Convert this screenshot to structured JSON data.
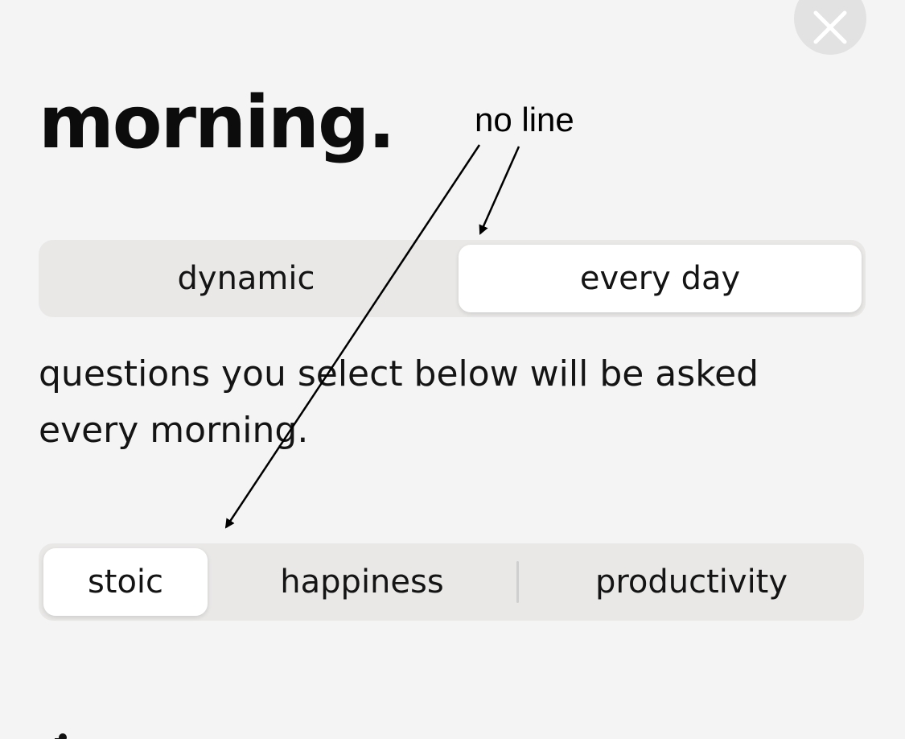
{
  "header": {
    "title": "morning.",
    "close_icon": "close-icon"
  },
  "frequency": {
    "options": [
      {
        "label": "dynamic",
        "selected": false
      },
      {
        "label": "every day",
        "selected": true
      }
    ]
  },
  "description": "questions you select below will be asked every morning.",
  "categories": {
    "options": [
      {
        "label": "stoic",
        "selected": true
      },
      {
        "label": "happiness",
        "selected": false
      },
      {
        "label": "productivity",
        "selected": false
      }
    ]
  },
  "annotation": {
    "text": "no line"
  },
  "colors": {
    "background": "#f4f4f4",
    "segment_track": "#e9e8e7",
    "segment_selected": "#ffffff",
    "close_button": "#e2e2e2"
  }
}
